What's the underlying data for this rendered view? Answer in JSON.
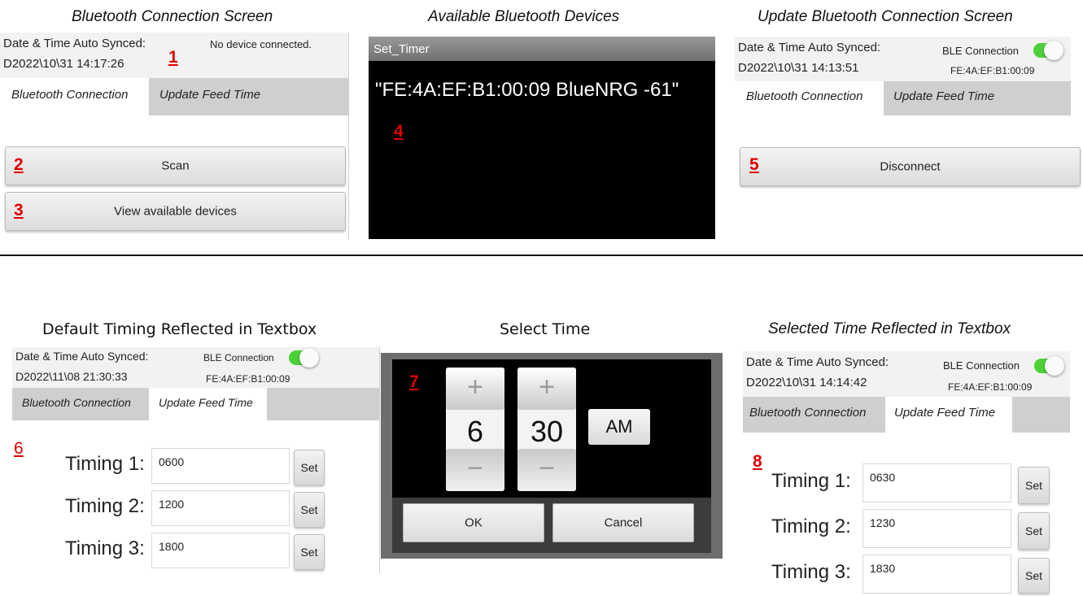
{
  "captions": {
    "bt_connection": "Bluetooth Connection Screen",
    "available_devices": "Available Bluetooth Devices",
    "update_connection": "Update Bluetooth Connection Screen",
    "default_timing": "Default Timing Reflected in Textbox",
    "select_time": "Select Time",
    "selected_time": "Selected Time Reflected in Textbox"
  },
  "markers": [
    "1",
    "2",
    "3",
    "4",
    "5",
    "6",
    "7",
    "8"
  ],
  "status": {
    "sync_label": "Date & Time Auto Synced:",
    "no_device": "No device connected.",
    "ble_label": "BLE Connection",
    "mac": "FE:4A:EF:B1:00:09",
    "time_p1": "D2022\\10\\31    14:17:26",
    "time_p3": "D2022\\10\\31    14:13:51",
    "time_p4": "D2022\\11\\08    21:30:33",
    "time_p6": "D2022\\10\\31    14:14:42",
    "colors": {
      "toggle_on": "#4cd137",
      "marker": "#e00000"
    }
  },
  "tabs": {
    "bluetooth": "Bluetooth Connection",
    "update_feed": "Update Feed Time"
  },
  "buttons": {
    "scan": "Scan",
    "view_devices": "View available devices",
    "disconnect": "Disconnect",
    "set": "Set",
    "ok": "OK",
    "cancel": "Cancel"
  },
  "devices_dialog": {
    "title": "Set_Timer",
    "device": "\"FE:4A:EF:B1:00:09 BlueNRG -61\""
  },
  "timing_labels": [
    "Timing 1:",
    "Timing 2:",
    "Timing 3:"
  ],
  "timing_default": [
    "0600",
    "1200",
    "1800"
  ],
  "timing_selected": [
    "0630",
    "1230",
    "1830"
  ],
  "picker": {
    "plus": "+",
    "minus": "−",
    "hour": "6",
    "minute": "30",
    "ampm": "AM"
  }
}
